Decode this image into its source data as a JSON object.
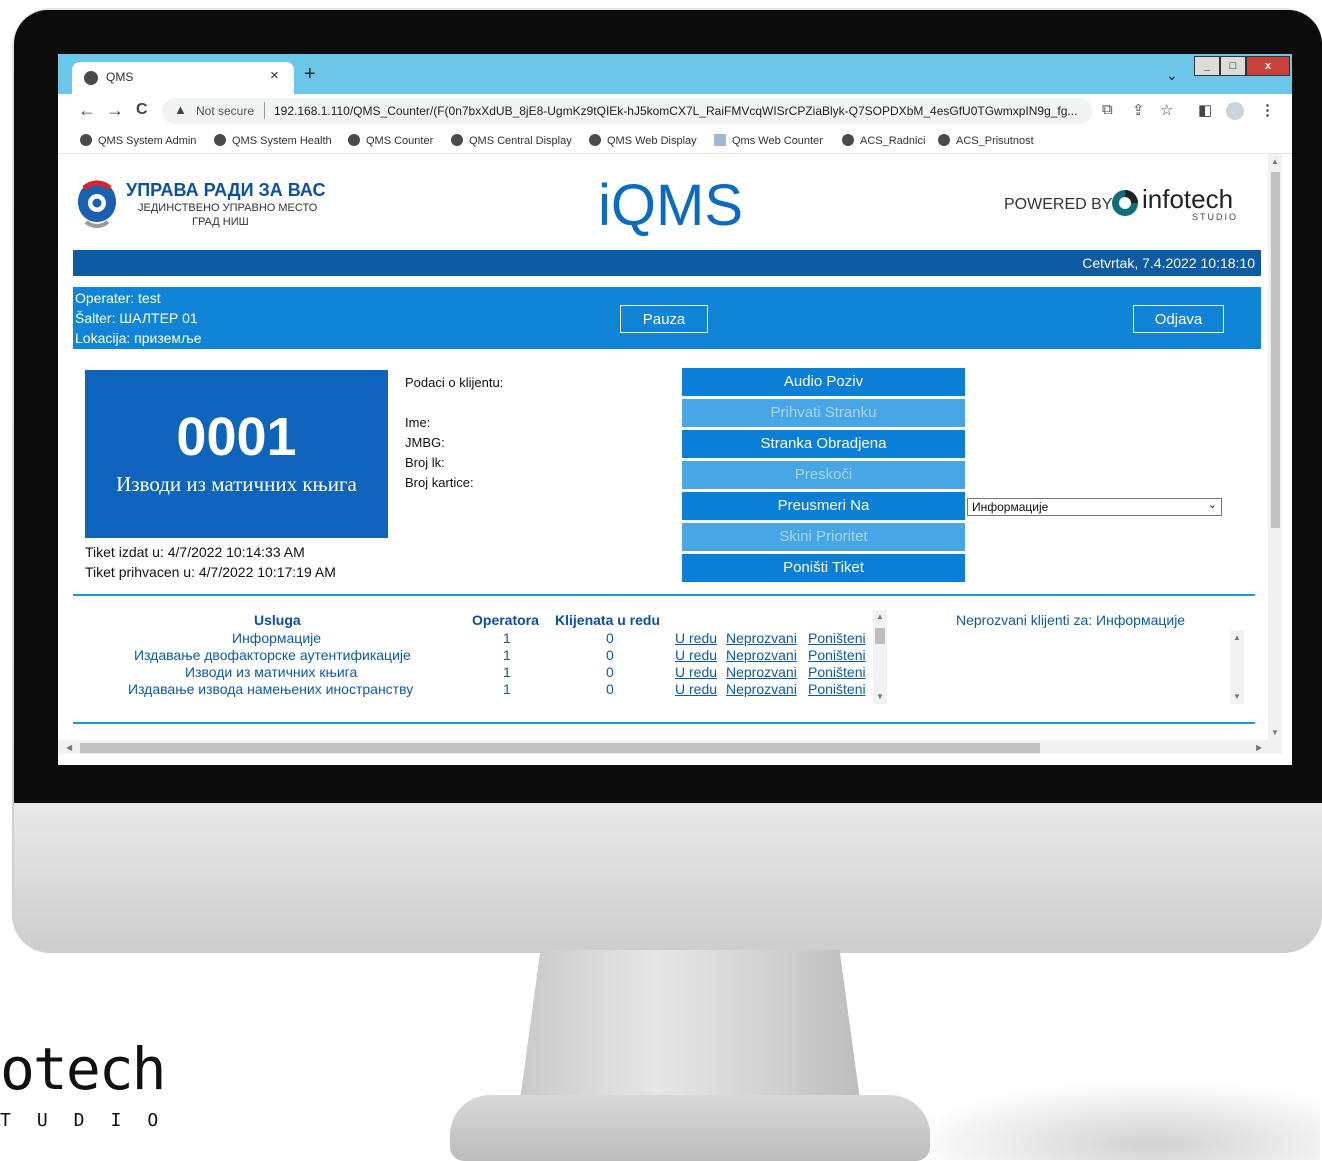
{
  "browser": {
    "tab_title": "QMS",
    "tab_close": "×",
    "new_tab": "+",
    "tab_list": "⌄",
    "window_min": "_",
    "window_max": "□",
    "window_close": "x",
    "back": "←",
    "forward": "→",
    "reload": "C",
    "security_warning": "Not secure",
    "url": "192.168.1.110/QMS_Counter/(F(0n7bxXdUB_8jE8-UgmKz9tQIEk-hJ5komCX7L_RaiFMVcqWISrCPZiaBlyk-Q7SOPDXbM_4esGfU0TGwmxpIN9g_fg...",
    "bookmarks": [
      "QMS System Admin",
      "QMS System Health",
      "QMS Counter",
      "QMS Central Display",
      "QMS Web Display",
      "Qms Web Counter",
      "ACS_Radnici",
      "ACS_Prisutnost"
    ]
  },
  "header": {
    "org_title": "УПРАВА РАДИ ЗА ВАС",
    "org_sub1": "ЈЕДИНСТВЕНО УПРАВНО МЕСТО",
    "org_sub2": "ГРАД НИШ",
    "app_name": "iQMS",
    "powered_by": "POWERED BY",
    "vendor": "infotech",
    "vendor_sub": "STUDIO"
  },
  "datebar": {
    "datetime": "Cetvrtak, 7.4.2022 10:18:10"
  },
  "operator": {
    "operater": "Operater: test",
    "salter": "Šalter: ШАЛТЕР 01",
    "lokacija": "Lokacija: приземље",
    "pause_label": "Pauza",
    "logout_label": "Odjava"
  },
  "ticket": {
    "number": "0001",
    "service": "Изводи из матичних књига",
    "issued": "Tiket izdat u: 4/7/2022 10:14:33 AM",
    "accepted": "Tiket prihvacen u: 4/7/2022 10:17:19 AM"
  },
  "client": {
    "heading": "Podaci o klijentu:",
    "ime": "Ime:",
    "jmbg": "JMBG:",
    "broj_lk": "Broj lk:",
    "broj_kartice": "Broj kartice:"
  },
  "actions": {
    "audio_poziv": "Audio Poziv",
    "prihvati": "Prihvati Stranku",
    "obradjena": "Stranka Obradjena",
    "preskoci": "Preskoči",
    "preusmeri": "Preusmeri Na",
    "skini_prioritet": "Skini Prioritet",
    "ponisti_tiket": "Poništi Tiket",
    "redirect_selected": "Информације"
  },
  "services_table": {
    "headers": [
      "Usluga",
      "Operatora",
      "Klijenata u redu"
    ],
    "link_labels": [
      "U redu",
      "Neprozvani",
      "Poništeni"
    ],
    "rows": [
      {
        "name": "Информације",
        "operators": "1",
        "queue": "0"
      },
      {
        "name": "Издавање двофакторске аутентификације",
        "operators": "1",
        "queue": "0"
      },
      {
        "name": "Изводи из матичних књига",
        "operators": "1",
        "queue": "0"
      },
      {
        "name": "Издавање извода намењених иностранству",
        "operators": "1",
        "queue": "0"
      }
    ]
  },
  "uncalled": {
    "title": "Neprozvani klijenti za: Информације"
  },
  "branding": {
    "word": "otech",
    "sub": "TUDIO"
  },
  "colors": {
    "title_bar": "#6bc6e9",
    "date_bar": "#0d5aa5",
    "operator_bar": "#1085d8",
    "ticket_box": "#0d64ba",
    "button_active": "#0b7fd8",
    "button_disabled": "#48a6e6"
  }
}
